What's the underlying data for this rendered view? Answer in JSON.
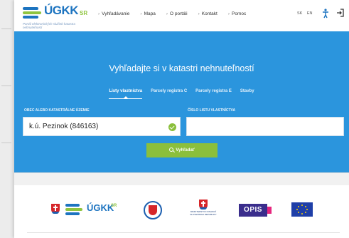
{
  "header": {
    "logo_text": "ÚGKK",
    "logo_suffix": "SR",
    "logo_tagline": "Portál elektronických služieb katastra nehnuteľností",
    "nav": [
      {
        "label": "Vyhľadávanie"
      },
      {
        "label": "Mapa"
      },
      {
        "label": "O portáli"
      },
      {
        "label": "Kontakt"
      },
      {
        "label": "Pomoc"
      }
    ],
    "languages": [
      "SK",
      "EN"
    ]
  },
  "hero": {
    "title": "Vyhľadajte si v katastri nehnuteľností",
    "tabs": [
      {
        "label": "Listy vlastníctva",
        "active": true
      },
      {
        "label": "Parcely registra C",
        "active": false
      },
      {
        "label": "Parcely registra E",
        "active": false
      },
      {
        "label": "Stavby",
        "active": false
      }
    ],
    "field_municipality": {
      "label": "OBEC ALEBO KATASTRÁLNE ÚZEMIE",
      "value": "k.ú. Pezinok (846163)"
    },
    "field_lv": {
      "label": "ČÍSLO LISTU VLASTNÍCTVA",
      "value": ""
    },
    "search_button": "Vyhľadať"
  },
  "footer": {
    "ugkk_text": "ÚGKK",
    "ugkk_suffix": "SR",
    "mf_text": "MINISTERSTVO FINANCIÍ SLOVENSKEJ REPUBLIKY",
    "oplis_text": "OPIS"
  },
  "colors": {
    "hero_bg": "#2b95dd",
    "accent_green": "#8bbf3c",
    "brand_blue": "#1d74c0"
  }
}
